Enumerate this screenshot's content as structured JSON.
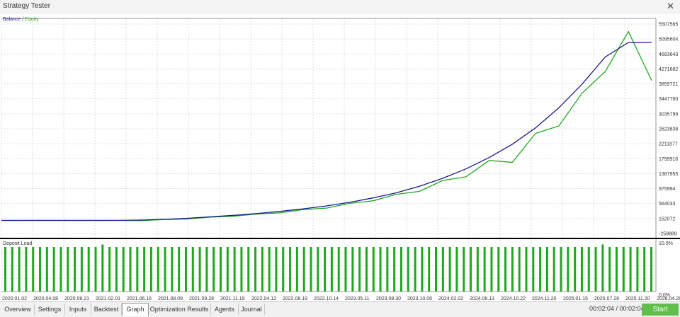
{
  "window": {
    "title": "Strategy Tester",
    "close_glyph": "✕"
  },
  "legend": {
    "balance": "Balance",
    "separator": " / ",
    "equity": "Equity"
  },
  "deposit_load": {
    "label": "Deposit Load",
    "top_tick": "10.0%",
    "bottom_tick": "0.0%"
  },
  "tabs": [
    {
      "label": "Overview"
    },
    {
      "label": "Settings"
    },
    {
      "label": "Inputs"
    },
    {
      "label": "Backtest"
    },
    {
      "label": "Graph"
    },
    {
      "label": "Optimization Results"
    },
    {
      "label": "Agents"
    },
    {
      "label": "Journal"
    }
  ],
  "status": {
    "timer": "00:02:04 / 00:02:04",
    "start_label": "Start"
  },
  "colors": {
    "balance": "#1a1a8c",
    "equity": "#1fa81f",
    "bars": "#1fa81f",
    "start": "#5fbf4a"
  },
  "chart_data": {
    "type": "line",
    "series": [
      {
        "name": "Balance",
        "values": [
          100000,
          100000,
          100000,
          100000,
          100000,
          100000,
          110000,
          130000,
          160000,
          200000,
          240000,
          290000,
          350000,
          420000,
          500000,
          600000,
          720000,
          860000,
          1040000,
          1260000,
          1520000,
          1830000,
          2200000,
          2650000,
          3200000,
          3850000,
          4600000,
          5000000,
          5000000
        ]
      },
      {
        "name": "Equity",
        "values": [
          100000,
          100000,
          100000,
          100000,
          100000,
          100000,
          95000,
          125000,
          140000,
          190000,
          215000,
          275000,
          310000,
          400000,
          440000,
          570000,
          640000,
          820000,
          900000,
          1200000,
          1300000,
          1750000,
          1700000,
          2500000,
          2700000,
          3600000,
          4200000,
          5300000,
          3950000
        ]
      }
    ],
    "x": [
      "2020.01.02",
      "2020.04.08",
      "2020.08.21",
      "2021.02.01",
      "2021.06.16",
      "2021.08.09",
      "2021.09.28",
      "2021.11.19",
      "2022.04.12",
      "2022.08.19",
      "2022.10.14",
      "2023.05.11",
      "2023.08.30",
      "2023.10.06",
      "2024.02.02",
      "2024.06.13",
      "2024.10.22",
      "2024.11.20",
      "2025.01.15",
      "2025.07.28",
      "2025.11.20",
      "2026.04.28"
    ],
    "yticks": [
      "5507565",
      "5095604",
      "4683643",
      "4271682",
      "3859721",
      "3447760",
      "3035799",
      "2623838",
      "2211877",
      "1799916",
      "1387955",
      "975994",
      "564033",
      "152072",
      "-259889"
    ],
    "ylim": [
      -259889,
      5507565
    ],
    "deposit_load_values": [
      9,
      9,
      9,
      9,
      9,
      9,
      9,
      9,
      9,
      9,
      9,
      9,
      9,
      9,
      9.5,
      9,
      9,
      9,
      9,
      9,
      9,
      9,
      9,
      9,
      9,
      9,
      9,
      9,
      9,
      9,
      9,
      9,
      9,
      9,
      9,
      9,
      9,
      9,
      9,
      9,
      9,
      9,
      9,
      9,
      9,
      9,
      9,
      9,
      9,
      9,
      9,
      9,
      9,
      9,
      9,
      9,
      9,
      9,
      9,
      9,
      9,
      9,
      9,
      9,
      9,
      9,
      9,
      9,
      9,
      9,
      9,
      9,
      9,
      9,
      9,
      9,
      9,
      9,
      9,
      9,
      9,
      9,
      9,
      9,
      9,
      9,
      9.5,
      9,
      9,
      9,
      9,
      9,
      9,
      9
    ],
    "deposit_load_ylim": [
      0,
      10
    ],
    "grid": true,
    "legend": "top-left"
  }
}
